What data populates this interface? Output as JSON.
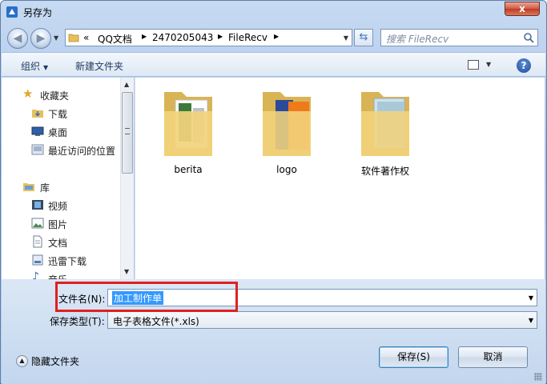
{
  "window": {
    "title": "另存为",
    "close_glyph": "x"
  },
  "address": {
    "overflow": "«",
    "crumbs": [
      "QQ文档",
      "2470205043",
      "FileRecv"
    ],
    "search_placeholder": "搜索 FileRecv"
  },
  "toolbar": {
    "organize": "组织",
    "new_folder": "新建文件夹",
    "help": "?"
  },
  "nav": {
    "favorites": "收藏夹",
    "downloads": "下载",
    "desktop": "桌面",
    "recent": "最近访问的位置",
    "libraries": "库",
    "videos": "视频",
    "pictures": "图片",
    "documents": "文档",
    "xunlei": "迅雷下载",
    "music": "音乐"
  },
  "folders": [
    {
      "name": "berita"
    },
    {
      "name": "logo"
    },
    {
      "name": "软件著作权"
    }
  ],
  "form": {
    "filename_label": "文件名(N):",
    "filename_value": "加工制作单",
    "type_label": "保存类型(T):",
    "type_value": "电子表格文件(*.xls)"
  },
  "footer": {
    "hide_folders": "隐藏文件夹",
    "save": "保存(S)",
    "cancel": "取消"
  },
  "colors": {
    "frame": "#b8cfee",
    "close": "#c03a22",
    "selection": "#3399ff",
    "highlight": "#e02020"
  }
}
